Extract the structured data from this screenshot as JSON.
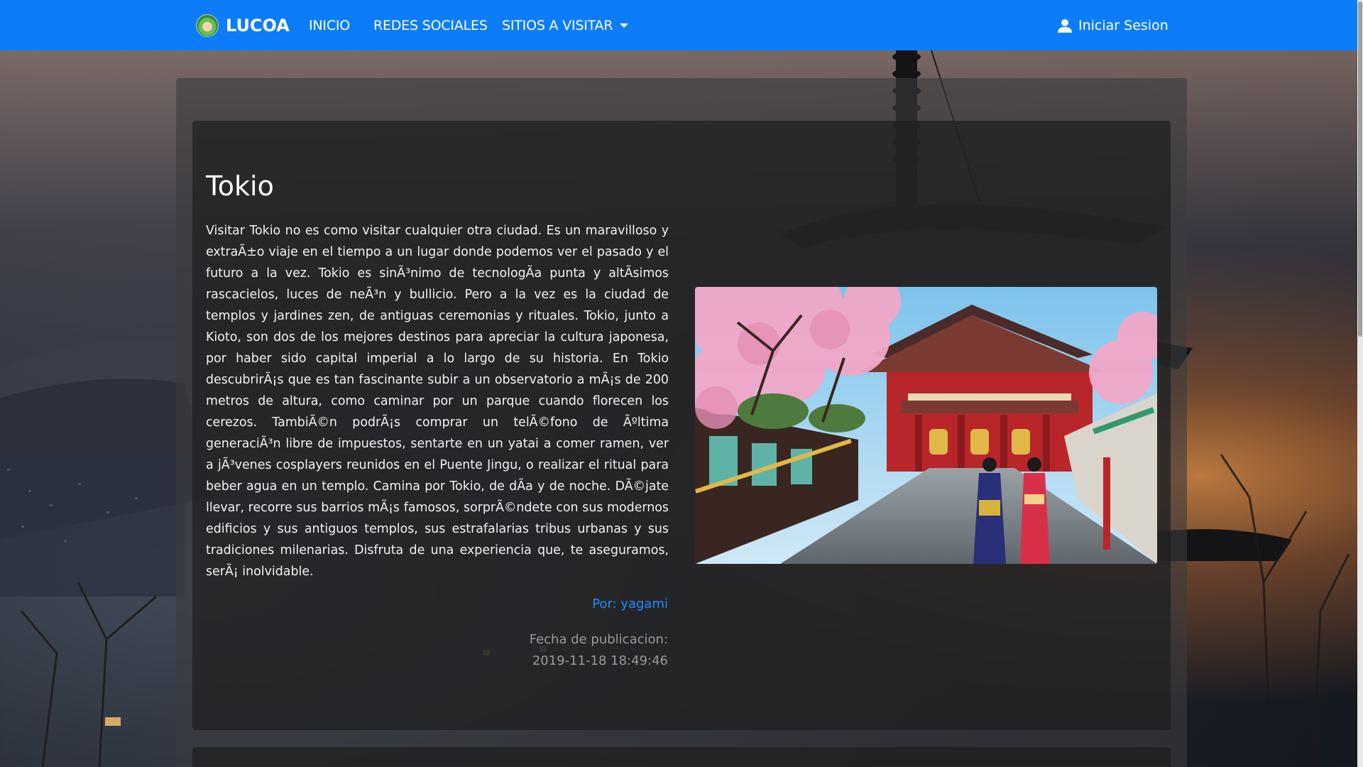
{
  "nav": {
    "brand": "LUCOA",
    "links": [
      "INICIO",
      "REDES SOCIALES",
      "SITIOS A VISITAR"
    ],
    "login": "Iniciar Sesion"
  },
  "article": {
    "title": "Tokio",
    "body": "Visitar Tokio no es como visitar cualquier otra ciudad. Es un maravilloso y extraÃ±o viaje en el tiempo a un lugar donde podemos ver el pasado y el futuro a la vez. Tokio es sinÃ³nimo de tecnologÃa punta y altÃsimos rascacielos, luces de neÃ³n y bullicio. Pero a la vez es la ciudad de templos y jardines zen, de antiguas ceremonias y rituales. Tokio, junto a Kioto, son dos de los mejores destinos para apreciar la cultura japonesa, por haber sido capital imperial a lo largo de su historia. En Tokio descubrirÃ¡s que es tan fascinante subir a un observatorio a mÃ¡s de 200 metros de altura, como caminar por un parque cuando florecen los cerezos. TambiÃ©n podrÃ¡s comprar un telÃ©fono de Ãºltima generaciÃ³n libre de impuestos, sentarte en un yatai a comer ramen, ver a jÃ³venes cosplayers reunidos en el Puente Jingu, o realizar el ritual para beber agua en un templo. Camina por Tokio, de dÃa y de noche. DÃ©jate llevar, recorre sus barrios mÃ¡s famosos, sorprÃ©ndete con sus modernos edificios y sus antiguos templos, sus estrafalarias tribus urbanas y sus tradiciones milenarias. Disfruta de una experiencia que, te aseguramos, serÃ¡ inolvidable.",
    "author": "Por: yagami",
    "date_label": "Fecha de publicacion:",
    "date_value": "2019-11-18 18:49:46"
  },
  "icons": {
    "brand": "lucoa-logo-icon",
    "user": "user-icon",
    "dropdown": "caret-down-icon"
  },
  "colors": {
    "navbar": "#0d7cf9",
    "author_link": "#1f8cff",
    "muted_text": "#9a9a9a"
  }
}
